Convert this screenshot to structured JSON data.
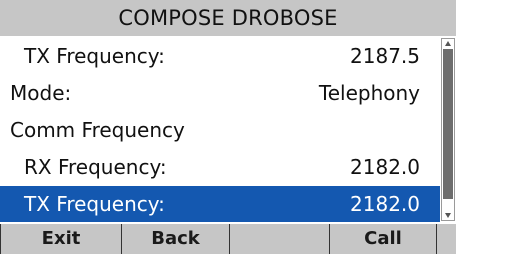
{
  "title": "COMPOSE DROBOSE",
  "rows": [
    {
      "label": "TX Frequency:",
      "value": "2187.5"
    },
    {
      "label": "Mode:",
      "value": "Telephony"
    },
    {
      "label": "Comm Frequency",
      "value": ""
    },
    {
      "label": "RX Frequency:",
      "value": "2182.0"
    },
    {
      "label": "TX Frequency:",
      "value": "2182.0"
    }
  ],
  "softkeys": [
    "Exit",
    "Back",
    "",
    "Call"
  ],
  "colors": {
    "title_bg": "#c6c6c6",
    "softkey_bg": "#c6c6c6",
    "selection": "#1458b0"
  }
}
